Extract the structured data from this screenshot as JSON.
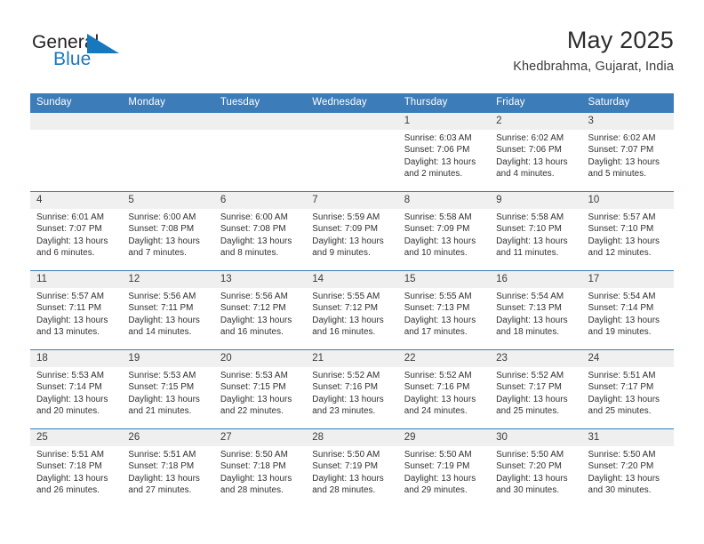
{
  "brand": {
    "word_one": "General",
    "word_two": "Blue",
    "flag_icon": "blue-triangle-flag-icon",
    "color_dark": "#231f20",
    "color_blue": "#1878be"
  },
  "header": {
    "title": "May 2025",
    "location": "Khedbrahma, Gujarat, India"
  },
  "theme": {
    "header_blue": "#3c7cb8",
    "date_band": "#f0f0f0",
    "grid_line": "#3c7cb8",
    "text": "#2f2f2f"
  },
  "calendar": {
    "weekdays": [
      "Sunday",
      "Monday",
      "Tuesday",
      "Wednesday",
      "Thursday",
      "Friday",
      "Saturday"
    ],
    "labels": {
      "sunrise_prefix": "Sunrise: ",
      "sunset_prefix": "Sunset: ",
      "daylight_prefix": "Daylight: "
    },
    "weeks": [
      [
        {
          "date": "",
          "sunrise": "",
          "sunset": "",
          "daylight_line1": "",
          "daylight_line2": ""
        },
        {
          "date": "",
          "sunrise": "",
          "sunset": "",
          "daylight_line1": "",
          "daylight_line2": ""
        },
        {
          "date": "",
          "sunrise": "",
          "sunset": "",
          "daylight_line1": "",
          "daylight_line2": ""
        },
        {
          "date": "",
          "sunrise": "",
          "sunset": "",
          "daylight_line1": "",
          "daylight_line2": ""
        },
        {
          "date": "1",
          "sunrise": "Sunrise: 6:03 AM",
          "sunset": "Sunset: 7:06 PM",
          "daylight_line1": "Daylight: 13 hours",
          "daylight_line2": "and 2 minutes."
        },
        {
          "date": "2",
          "sunrise": "Sunrise: 6:02 AM",
          "sunset": "Sunset: 7:06 PM",
          "daylight_line1": "Daylight: 13 hours",
          "daylight_line2": "and 4 minutes."
        },
        {
          "date": "3",
          "sunrise": "Sunrise: 6:02 AM",
          "sunset": "Sunset: 7:07 PM",
          "daylight_line1": "Daylight: 13 hours",
          "daylight_line2": "and 5 minutes."
        }
      ],
      [
        {
          "date": "4",
          "sunrise": "Sunrise: 6:01 AM",
          "sunset": "Sunset: 7:07 PM",
          "daylight_line1": "Daylight: 13 hours",
          "daylight_line2": "and 6 minutes."
        },
        {
          "date": "5",
          "sunrise": "Sunrise: 6:00 AM",
          "sunset": "Sunset: 7:08 PM",
          "daylight_line1": "Daylight: 13 hours",
          "daylight_line2": "and 7 minutes."
        },
        {
          "date": "6",
          "sunrise": "Sunrise: 6:00 AM",
          "sunset": "Sunset: 7:08 PM",
          "daylight_line1": "Daylight: 13 hours",
          "daylight_line2": "and 8 minutes."
        },
        {
          "date": "7",
          "sunrise": "Sunrise: 5:59 AM",
          "sunset": "Sunset: 7:09 PM",
          "daylight_line1": "Daylight: 13 hours",
          "daylight_line2": "and 9 minutes."
        },
        {
          "date": "8",
          "sunrise": "Sunrise: 5:58 AM",
          "sunset": "Sunset: 7:09 PM",
          "daylight_line1": "Daylight: 13 hours",
          "daylight_line2": "and 10 minutes."
        },
        {
          "date": "9",
          "sunrise": "Sunrise: 5:58 AM",
          "sunset": "Sunset: 7:10 PM",
          "daylight_line1": "Daylight: 13 hours",
          "daylight_line2": "and 11 minutes."
        },
        {
          "date": "10",
          "sunrise": "Sunrise: 5:57 AM",
          "sunset": "Sunset: 7:10 PM",
          "daylight_line1": "Daylight: 13 hours",
          "daylight_line2": "and 12 minutes."
        }
      ],
      [
        {
          "date": "11",
          "sunrise": "Sunrise: 5:57 AM",
          "sunset": "Sunset: 7:11 PM",
          "daylight_line1": "Daylight: 13 hours",
          "daylight_line2": "and 13 minutes."
        },
        {
          "date": "12",
          "sunrise": "Sunrise: 5:56 AM",
          "sunset": "Sunset: 7:11 PM",
          "daylight_line1": "Daylight: 13 hours",
          "daylight_line2": "and 14 minutes."
        },
        {
          "date": "13",
          "sunrise": "Sunrise: 5:56 AM",
          "sunset": "Sunset: 7:12 PM",
          "daylight_line1": "Daylight: 13 hours",
          "daylight_line2": "and 16 minutes."
        },
        {
          "date": "14",
          "sunrise": "Sunrise: 5:55 AM",
          "sunset": "Sunset: 7:12 PM",
          "daylight_line1": "Daylight: 13 hours",
          "daylight_line2": "and 16 minutes."
        },
        {
          "date": "15",
          "sunrise": "Sunrise: 5:55 AM",
          "sunset": "Sunset: 7:13 PM",
          "daylight_line1": "Daylight: 13 hours",
          "daylight_line2": "and 17 minutes."
        },
        {
          "date": "16",
          "sunrise": "Sunrise: 5:54 AM",
          "sunset": "Sunset: 7:13 PM",
          "daylight_line1": "Daylight: 13 hours",
          "daylight_line2": "and 18 minutes."
        },
        {
          "date": "17",
          "sunrise": "Sunrise: 5:54 AM",
          "sunset": "Sunset: 7:14 PM",
          "daylight_line1": "Daylight: 13 hours",
          "daylight_line2": "and 19 minutes."
        }
      ],
      [
        {
          "date": "18",
          "sunrise": "Sunrise: 5:53 AM",
          "sunset": "Sunset: 7:14 PM",
          "daylight_line1": "Daylight: 13 hours",
          "daylight_line2": "and 20 minutes."
        },
        {
          "date": "19",
          "sunrise": "Sunrise: 5:53 AM",
          "sunset": "Sunset: 7:15 PM",
          "daylight_line1": "Daylight: 13 hours",
          "daylight_line2": "and 21 minutes."
        },
        {
          "date": "20",
          "sunrise": "Sunrise: 5:53 AM",
          "sunset": "Sunset: 7:15 PM",
          "daylight_line1": "Daylight: 13 hours",
          "daylight_line2": "and 22 minutes."
        },
        {
          "date": "21",
          "sunrise": "Sunrise: 5:52 AM",
          "sunset": "Sunset: 7:16 PM",
          "daylight_line1": "Daylight: 13 hours",
          "daylight_line2": "and 23 minutes."
        },
        {
          "date": "22",
          "sunrise": "Sunrise: 5:52 AM",
          "sunset": "Sunset: 7:16 PM",
          "daylight_line1": "Daylight: 13 hours",
          "daylight_line2": "and 24 minutes."
        },
        {
          "date": "23",
          "sunrise": "Sunrise: 5:52 AM",
          "sunset": "Sunset: 7:17 PM",
          "daylight_line1": "Daylight: 13 hours",
          "daylight_line2": "and 25 minutes."
        },
        {
          "date": "24",
          "sunrise": "Sunrise: 5:51 AM",
          "sunset": "Sunset: 7:17 PM",
          "daylight_line1": "Daylight: 13 hours",
          "daylight_line2": "and 25 minutes."
        }
      ],
      [
        {
          "date": "25",
          "sunrise": "Sunrise: 5:51 AM",
          "sunset": "Sunset: 7:18 PM",
          "daylight_line1": "Daylight: 13 hours",
          "daylight_line2": "and 26 minutes."
        },
        {
          "date": "26",
          "sunrise": "Sunrise: 5:51 AM",
          "sunset": "Sunset: 7:18 PM",
          "daylight_line1": "Daylight: 13 hours",
          "daylight_line2": "and 27 minutes."
        },
        {
          "date": "27",
          "sunrise": "Sunrise: 5:50 AM",
          "sunset": "Sunset: 7:18 PM",
          "daylight_line1": "Daylight: 13 hours",
          "daylight_line2": "and 28 minutes."
        },
        {
          "date": "28",
          "sunrise": "Sunrise: 5:50 AM",
          "sunset": "Sunset: 7:19 PM",
          "daylight_line1": "Daylight: 13 hours",
          "daylight_line2": "and 28 minutes."
        },
        {
          "date": "29",
          "sunrise": "Sunrise: 5:50 AM",
          "sunset": "Sunset: 7:19 PM",
          "daylight_line1": "Daylight: 13 hours",
          "daylight_line2": "and 29 minutes."
        },
        {
          "date": "30",
          "sunrise": "Sunrise: 5:50 AM",
          "sunset": "Sunset: 7:20 PM",
          "daylight_line1": "Daylight: 13 hours",
          "daylight_line2": "and 30 minutes."
        },
        {
          "date": "31",
          "sunrise": "Sunrise: 5:50 AM",
          "sunset": "Sunset: 7:20 PM",
          "daylight_line1": "Daylight: 13 hours",
          "daylight_line2": "and 30 minutes."
        }
      ]
    ]
  }
}
